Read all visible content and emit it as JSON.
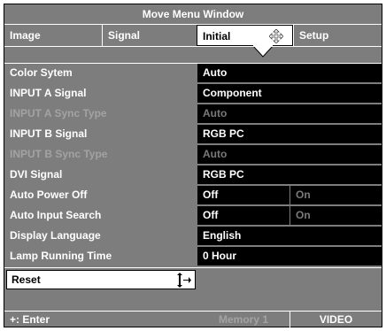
{
  "window": {
    "title": "Move Menu Window"
  },
  "tabs": [
    {
      "label": "Image"
    },
    {
      "label": "Signal"
    },
    {
      "label": "Initial"
    },
    {
      "label": "Setup"
    }
  ],
  "settings": [
    {
      "label": "Color Sytem",
      "value": "Auto"
    },
    {
      "label": "INPUT A Signal",
      "value": "Component"
    },
    {
      "label": "INPUT A Sync Type",
      "value": "Auto"
    },
    {
      "label": "INPUT B Signal",
      "value": "RGB PC"
    },
    {
      "label": "INPUT B Sync Type",
      "value": "Auto"
    },
    {
      "label": "DVI Signal",
      "value": "RGB PC"
    },
    {
      "label": "Auto Power Off",
      "value": "Off",
      "alt": "On"
    },
    {
      "label": "Auto Input Search",
      "value": "Off",
      "alt": "On"
    },
    {
      "label": "Display Language",
      "value": "English"
    },
    {
      "label": "Lamp Running Time",
      "value": "0 Hour"
    }
  ],
  "reset": {
    "label": "Reset"
  },
  "footer": {
    "enter": "+: Enter",
    "memory": "Memory 1",
    "input": "VIDEO"
  },
  "colors": {
    "panel": "#7d7d7d",
    "value_bg": "#000000",
    "dim_text": "#a3a3a3"
  },
  "icons": {
    "move": "move-arrows-icon",
    "pointer": "up-down-arrow-icon",
    "caret": "caret-down-icon"
  }
}
